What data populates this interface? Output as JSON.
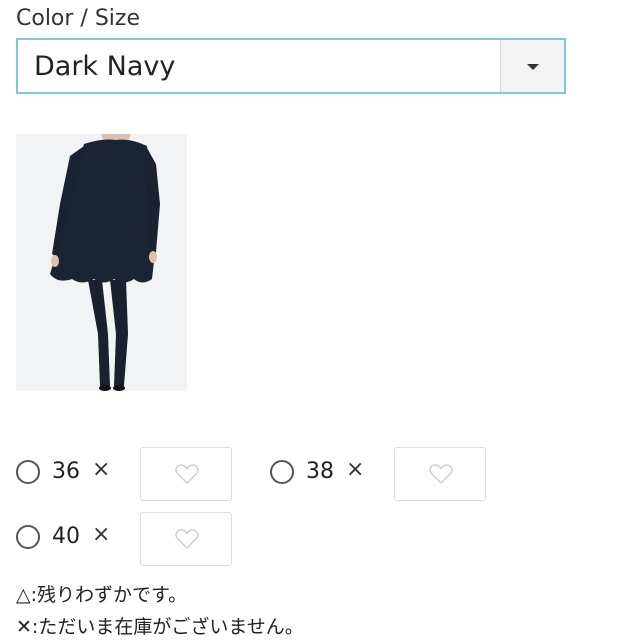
{
  "selector": {
    "label": "Color / Size",
    "value": "Dark Navy"
  },
  "product_image": {
    "alt": "Dark Navy tunic and pants outfit"
  },
  "sizes": [
    {
      "size": "36",
      "stock_mark": "×"
    },
    {
      "size": "38",
      "stock_mark": "×"
    },
    {
      "size": "40",
      "stock_mark": "×"
    }
  ],
  "legend": {
    "low_stock": "△:残りわずかです。",
    "out_of_stock": "✕:ただいま在庫がございません。"
  },
  "colors": {
    "select_border": "#7ec8d8",
    "garment": "#1c2333"
  },
  "icons": {
    "favorite": "heart-outline-icon",
    "dropdown": "caret-down-icon"
  }
}
